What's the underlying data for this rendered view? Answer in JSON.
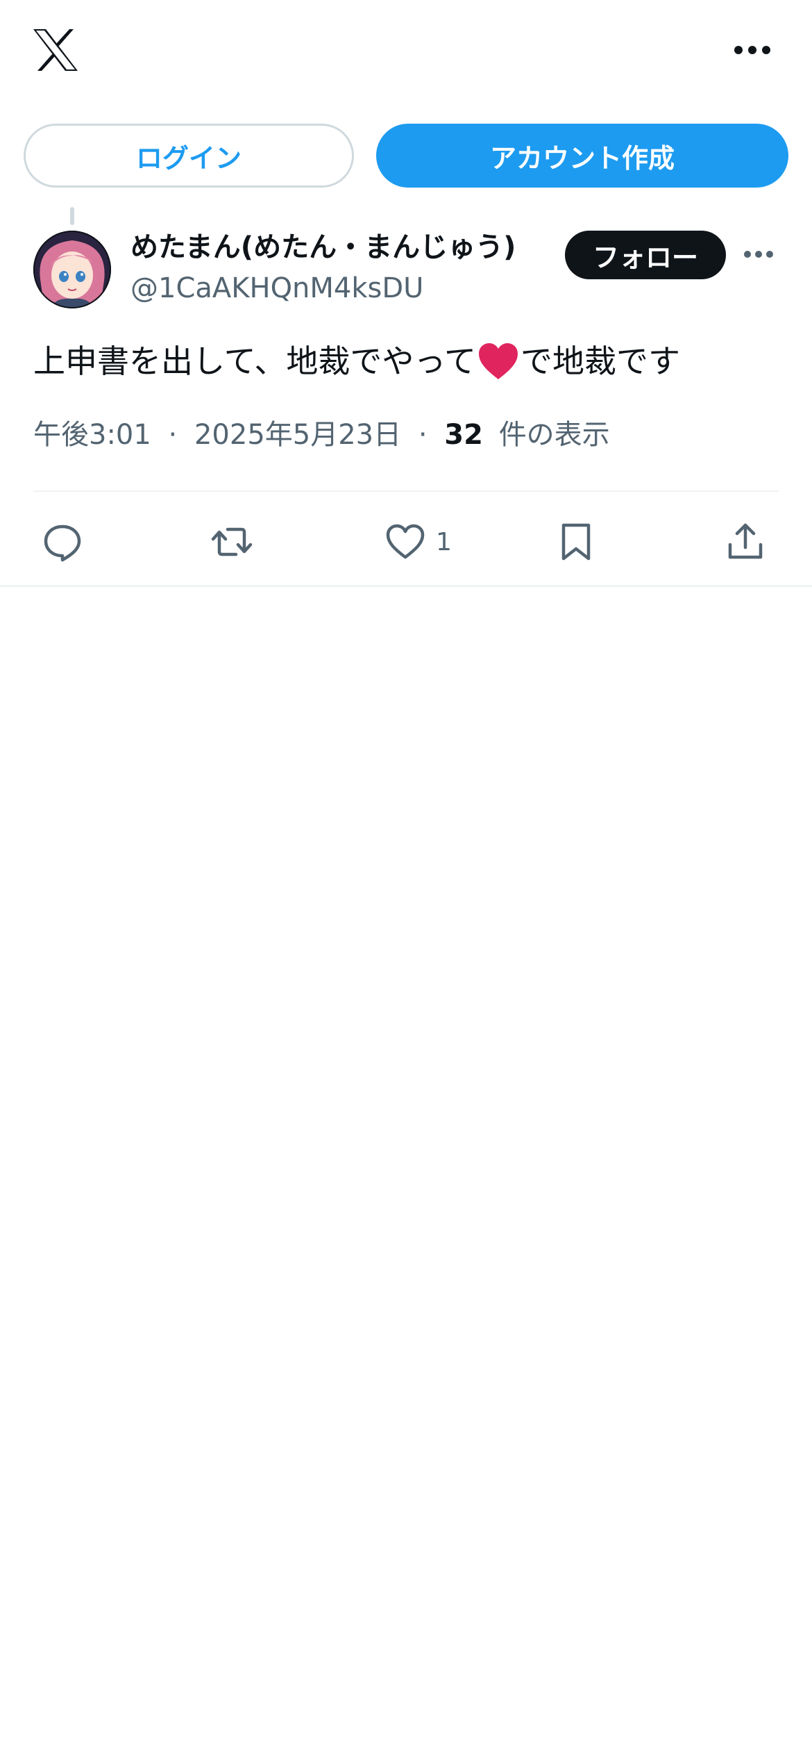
{
  "topbar": {
    "logo_icon": "x-logo-icon",
    "more_icon": "more-horizontal-icon"
  },
  "auth": {
    "login_label": "ログイン",
    "signup_label": "アカウント作成"
  },
  "post": {
    "author": {
      "display_name": "めたまん(めたん・まんじゅう)",
      "handle": "@1CaAKHQnM4ksDU",
      "avatar_icon": "avatar-anime-girl"
    },
    "follow_label": "フォロー",
    "text_before": "上申書を出して、地裁でやって",
    "emoji": "heart-emoji",
    "text_after": "で地裁です",
    "time": "午後3:01",
    "separator": "·",
    "date": "2025年5月23日",
    "views_count": "32",
    "views_label": "件の表示",
    "actions": {
      "reply_icon": "reply-icon",
      "retweet_icon": "retweet-icon",
      "like_icon": "heart-icon",
      "like_count": "1",
      "bookmark_icon": "bookmark-icon",
      "share_icon": "share-icon"
    }
  },
  "colors": {
    "accent": "#1d9bf0",
    "text": "#0f1419",
    "secondary": "#536471",
    "heart": "#e0245e"
  }
}
